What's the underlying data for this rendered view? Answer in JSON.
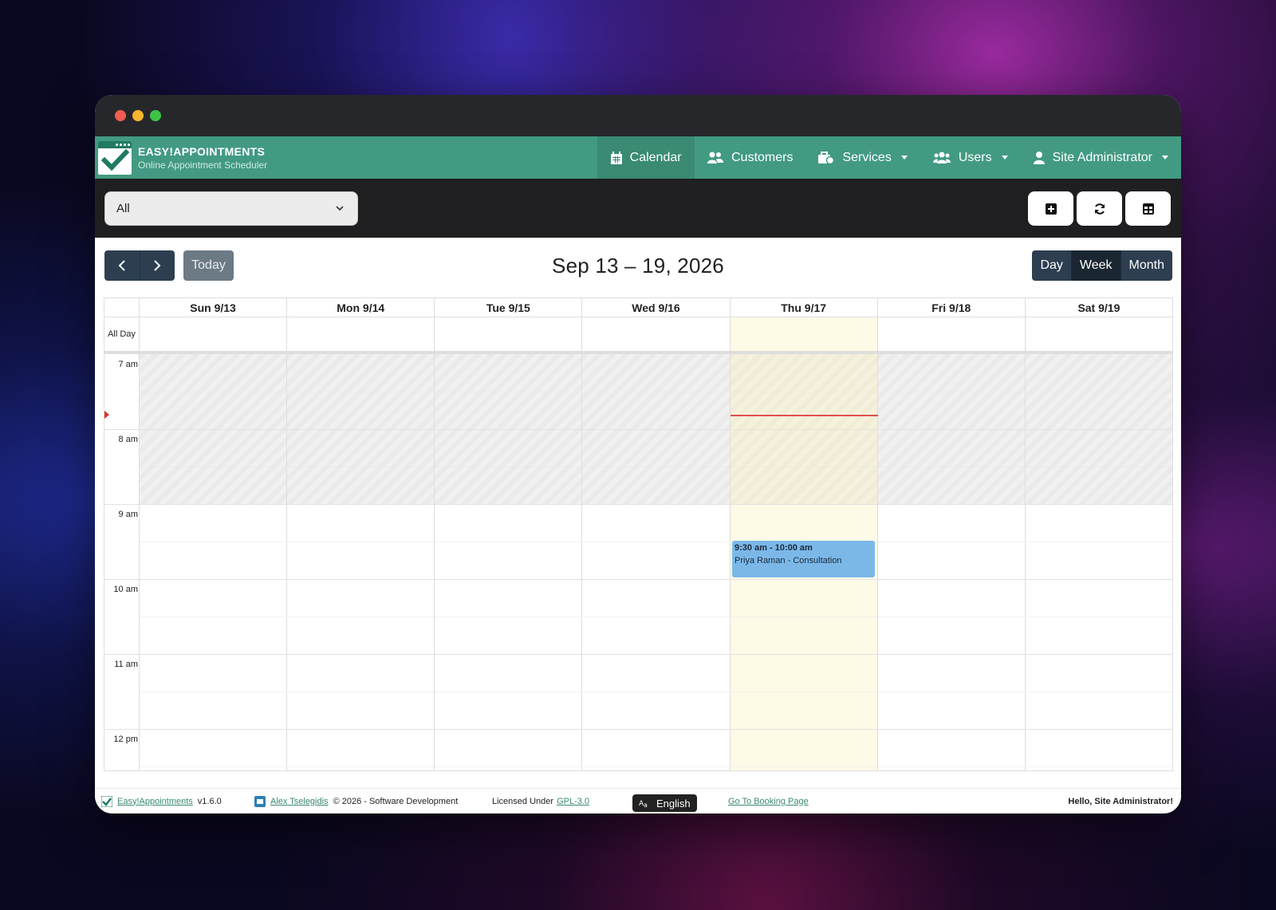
{
  "app": {
    "brand_title": "EASY!APPOINTMENTS",
    "brand_subtitle": "Online Appointment Scheduler",
    "accent_color": "#429a82"
  },
  "nav": [
    {
      "label": "Calendar",
      "icon": "calendar-icon",
      "active": true
    },
    {
      "label": "Customers",
      "icon": "users-icon"
    },
    {
      "label": "Services",
      "icon": "briefcase-icon",
      "dropdown": true
    },
    {
      "label": "Users",
      "icon": "user-group-icon",
      "dropdown": true
    },
    {
      "label": "Site Administrator",
      "icon": "user-icon",
      "dropdown": true
    }
  ],
  "toolbar": {
    "filter_value": "All",
    "buttons": [
      "add-appointment-icon",
      "refresh-icon",
      "table-view-icon"
    ]
  },
  "calendar": {
    "today_label": "Today",
    "range_title": "Sep 13 – 19, 2026",
    "views": [
      "Day",
      "Week",
      "Month"
    ],
    "active_view": "Week",
    "all_day_label": "All Day",
    "days": [
      "Sun 9/13",
      "Mon 9/14",
      "Tue 9/15",
      "Wed 9/16",
      "Thu 9/17",
      "Fri 9/18",
      "Sat 9/19"
    ],
    "today_index": 4,
    "hours": [
      "7 am",
      "8 am",
      "9 am",
      "10 am",
      "11 am",
      "12 pm"
    ],
    "event": {
      "time": "9:30 am - 10:00 am",
      "title": "Priya Raman - Consultation",
      "day_index": 4,
      "color": "#7bb8e8"
    }
  },
  "footer": {
    "app_link": "Easy!Appointments",
    "version": "v1.6.0",
    "author_link": "Alex Tselegidis",
    "copyright": "© 2026 - Software Development",
    "license_prefix": "Licensed Under",
    "license_link": "GPL-3.0",
    "language": "English",
    "booking_link": "Go To Booking Page",
    "greeting": "Hello, Site Administrator!"
  }
}
